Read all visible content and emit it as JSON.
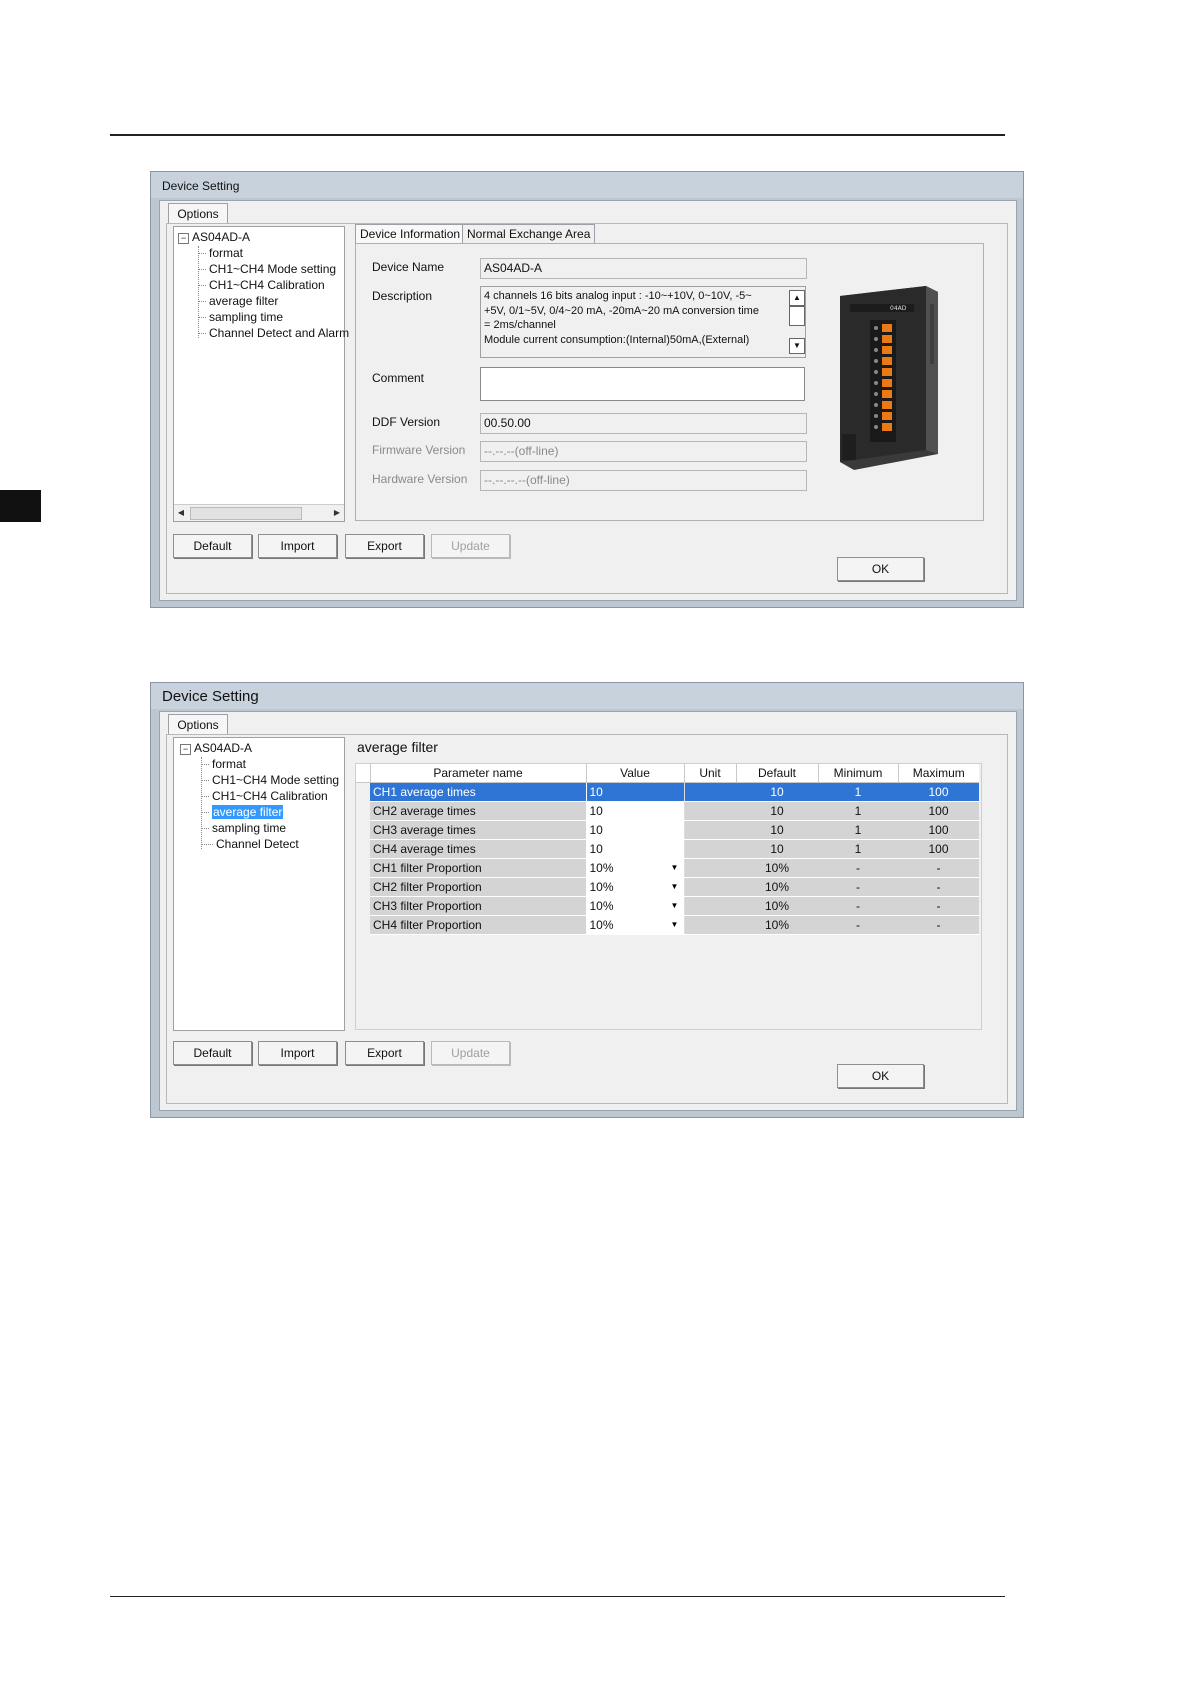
{
  "dialog1": {
    "title": "Device Setting",
    "options_tab": "Options",
    "tree": {
      "root": "AS04AD-A",
      "items": [
        "format",
        "CH1~CH4 Mode setting",
        "CH1~CH4 Calibration",
        "average filter",
        "sampling time",
        "Channel Detect and Alarm"
      ]
    },
    "tabs": [
      "Device Information",
      "Normal Exchange Area"
    ],
    "fields": {
      "device_name_label": "Device Name",
      "device_name_value": "AS04AD-A",
      "description_label": "Description",
      "description_lines": [
        "4 channels 16 bits analog input : -10~+10V, 0~10V, -5~",
        "+5V, 0/1~5V, 0/4~20 mA, -20mA~20 mA conversion time",
        "= 2ms/channel",
        "Module current consumption:(Internal)50mA,(External)"
      ],
      "comment_label": "Comment",
      "comment_value": "",
      "ddf_label": "DDF Version",
      "ddf_value": "00.50.00",
      "firmware_label": "Firmware Version",
      "firmware_value": "--.--.--(off-line)",
      "hardware_label": "Hardware Version",
      "hardware_value": "--.--.--.--(off-line)"
    },
    "device_label": "04AD",
    "buttons": {
      "default": "Default",
      "import": "Import",
      "export": "Export",
      "update": "Update",
      "ok": "OK"
    }
  },
  "dialog2": {
    "title": "Device Setting",
    "options_tab": "Options",
    "tree": {
      "root": "AS04AD-A",
      "items": [
        "format",
        "CH1~CH4 Mode setting",
        "CH1~CH4 Calibration",
        "average filter",
        "sampling time",
        "Channel Detect"
      ],
      "selected": "average filter"
    },
    "section_title": "average filter",
    "columns": [
      "Parameter name",
      "Value",
      "Unit",
      "Default",
      "Minimum",
      "Maximum"
    ],
    "rows": [
      {
        "name": "CH1 average times",
        "value": "10",
        "unit": "",
        "default": "10",
        "min": "1",
        "max": "100",
        "dropdown": false,
        "selected": true
      },
      {
        "name": "CH2 average times",
        "value": "10",
        "unit": "",
        "default": "10",
        "min": "1",
        "max": "100",
        "dropdown": false,
        "selected": false
      },
      {
        "name": "CH3 average times",
        "value": "10",
        "unit": "",
        "default": "10",
        "min": "1",
        "max": "100",
        "dropdown": false,
        "selected": false
      },
      {
        "name": "CH4 average times",
        "value": "10",
        "unit": "",
        "default": "10",
        "min": "1",
        "max": "100",
        "dropdown": false,
        "selected": false
      },
      {
        "name": "CH1 filter Proportion",
        "value": "10%",
        "unit": "",
        "default": "10%",
        "min": "-",
        "max": "-",
        "dropdown": true,
        "selected": false
      },
      {
        "name": "CH2 filter Proportion",
        "value": "10%",
        "unit": "",
        "default": "10%",
        "min": "-",
        "max": "-",
        "dropdown": true,
        "selected": false
      },
      {
        "name": "CH3 filter Proportion",
        "value": "10%",
        "unit": "",
        "default": "10%",
        "min": "-",
        "max": "-",
        "dropdown": true,
        "selected": false
      },
      {
        "name": "CH4 filter Proportion",
        "value": "10%",
        "unit": "",
        "default": "10%",
        "min": "-",
        "max": "-",
        "dropdown": true,
        "selected": false
      }
    ],
    "buttons": {
      "default": "Default",
      "import": "Import",
      "export": "Export",
      "update": "Update",
      "ok": "OK"
    }
  }
}
